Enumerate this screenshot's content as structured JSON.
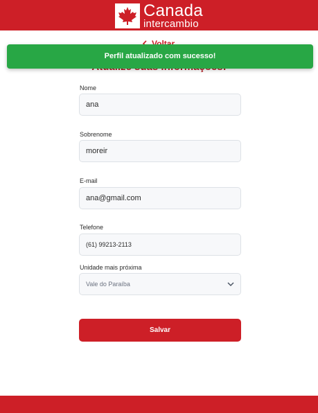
{
  "brand": {
    "name": "Canada",
    "sub": "intercambio",
    "color": "#cd1f27"
  },
  "nav": {
    "back_label": "Voltar"
  },
  "page": {
    "title": "Atualize suas informações:"
  },
  "toast": {
    "message": "Perfil atualizado com sucesso!",
    "color": "#28a745"
  },
  "form": {
    "nome": {
      "label": "Nome",
      "value": "ana"
    },
    "sobrenome": {
      "label": "Sobrenome",
      "value": "moreir"
    },
    "email": {
      "label": "E-mail",
      "value": "ana@gmail.com"
    },
    "telefone": {
      "label": "Telefone",
      "value": "(61) 99213-2113"
    },
    "unidade": {
      "label": "Unidade mais próxima",
      "value": "Vale do Paraíba"
    }
  },
  "actions": {
    "save_label": "Salvar"
  }
}
